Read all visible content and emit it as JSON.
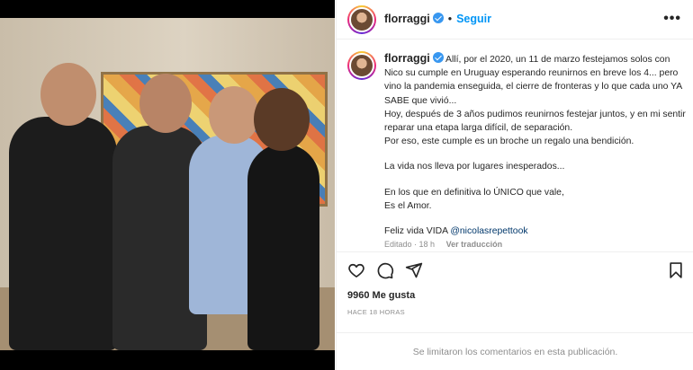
{
  "post": {
    "username": "florraggi",
    "follow_label": "Seguir",
    "more_label": "•••",
    "dot": "•"
  },
  "caption": {
    "lines": [
      "Allí, por el 2020, un 11 de marzo festejamos solos con Nico su cumple en Uruguay esperando reunirnos en breve los 4... pero vino la pandemia enseguida, el cierre de fronteras y lo que cada uno YA SABE que vivió...",
      "Hoy, después de 3 años pudimos reunirnos festejar juntos, y en mi sentir reparar una etapa larga difícil, de separación.",
      "Por eso, este cumple es un broche un regalo una bendición.",
      "La vida nos lleva por lugares inesperados...",
      "En los que en definitiva lo ÚNICO que vale,",
      "Es el Amor.",
      "Feliz vida VIDA"
    ],
    "mention": "@nicolasrepettook",
    "edited": "Editado · 18 h",
    "translate": "Ver traducción"
  },
  "engagement": {
    "likes": "9960 Me gusta",
    "time_ago": "HACE 18 HORAS"
  },
  "comments_disabled": "Se limitaron los comentarios en esta publicación.",
  "icons": {
    "like": "heart-icon",
    "comment": "comment-icon",
    "share": "share-icon",
    "save": "bookmark-icon",
    "verified": "verified-badge-icon",
    "more": "more-options-icon"
  },
  "colors": {
    "accent": "#0095f6",
    "verified": "#3897f0",
    "text": "#262626",
    "muted": "#8e8e8e",
    "mention": "#00376b"
  }
}
